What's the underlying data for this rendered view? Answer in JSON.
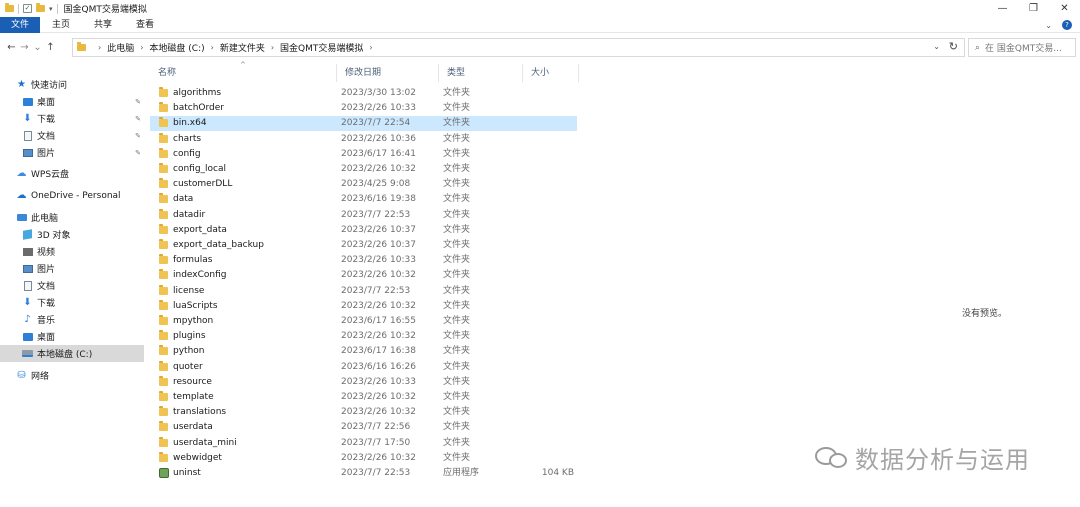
{
  "window": {
    "title": "国金QMT交易端模拟",
    "minimize": "—",
    "maximize": "❐",
    "close": "✕"
  },
  "ribbon": {
    "tabs": [
      "文件",
      "主页",
      "共享",
      "查看"
    ],
    "expand": "⌄",
    "help": "?"
  },
  "address": {
    "crumbs": [
      "此电脑",
      "本地磁盘 (C:)",
      "新建文件夹",
      "国金QMT交易端模拟"
    ],
    "search_placeholder": "在 国金QMT交易..."
  },
  "sidebar": {
    "quick_access": "快速访问",
    "quick_items": [
      "桌面",
      "下载",
      "文档",
      "图片"
    ],
    "wps": "WPS云盘",
    "onedrive": "OneDrive - Personal",
    "this_pc": "此电脑",
    "pc_items": [
      "3D 对象",
      "视频",
      "图片",
      "文档",
      "下载",
      "音乐",
      "桌面",
      "本地磁盘 (C:)"
    ],
    "network": "网络"
  },
  "columns": {
    "name": "名称",
    "date": "修改日期",
    "type": "类型",
    "size": "大小"
  },
  "files": [
    {
      "name": "algorithms",
      "date": "2023/3/30 13:02",
      "type": "文件夹",
      "size": ""
    },
    {
      "name": "batchOrder",
      "date": "2023/2/26 10:33",
      "type": "文件夹",
      "size": ""
    },
    {
      "name": "bin.x64",
      "date": "2023/7/7 22:54",
      "type": "文件夹",
      "size": ""
    },
    {
      "name": "charts",
      "date": "2023/2/26 10:36",
      "type": "文件夹",
      "size": ""
    },
    {
      "name": "config",
      "date": "2023/6/17 16:41",
      "type": "文件夹",
      "size": ""
    },
    {
      "name": "config_local",
      "date": "2023/2/26 10:32",
      "type": "文件夹",
      "size": ""
    },
    {
      "name": "customerDLL",
      "date": "2023/4/25 9:08",
      "type": "文件夹",
      "size": ""
    },
    {
      "name": "data",
      "date": "2023/6/16 19:38",
      "type": "文件夹",
      "size": ""
    },
    {
      "name": "datadir",
      "date": "2023/7/7 22:53",
      "type": "文件夹",
      "size": ""
    },
    {
      "name": "export_data",
      "date": "2023/2/26 10:37",
      "type": "文件夹",
      "size": ""
    },
    {
      "name": "export_data_backup",
      "date": "2023/2/26 10:37",
      "type": "文件夹",
      "size": ""
    },
    {
      "name": "formulas",
      "date": "2023/2/26 10:33",
      "type": "文件夹",
      "size": ""
    },
    {
      "name": "indexConfig",
      "date": "2023/2/26 10:32",
      "type": "文件夹",
      "size": ""
    },
    {
      "name": "license",
      "date": "2023/7/7 22:53",
      "type": "文件夹",
      "size": ""
    },
    {
      "name": "luaScripts",
      "date": "2023/2/26 10:32",
      "type": "文件夹",
      "size": ""
    },
    {
      "name": "mpython",
      "date": "2023/6/17 16:55",
      "type": "文件夹",
      "size": ""
    },
    {
      "name": "plugins",
      "date": "2023/2/26 10:32",
      "type": "文件夹",
      "size": ""
    },
    {
      "name": "python",
      "date": "2023/6/17 16:38",
      "type": "文件夹",
      "size": ""
    },
    {
      "name": "quoter",
      "date": "2023/6/16 16:26",
      "type": "文件夹",
      "size": ""
    },
    {
      "name": "resource",
      "date": "2023/2/26 10:33",
      "type": "文件夹",
      "size": ""
    },
    {
      "name": "template",
      "date": "2023/2/26 10:32",
      "type": "文件夹",
      "size": ""
    },
    {
      "name": "translations",
      "date": "2023/2/26 10:32",
      "type": "文件夹",
      "size": ""
    },
    {
      "name": "userdata",
      "date": "2023/7/7 22:56",
      "type": "文件夹",
      "size": ""
    },
    {
      "name": "userdata_mini",
      "date": "2023/7/7 17:50",
      "type": "文件夹",
      "size": ""
    },
    {
      "name": "webwidget",
      "date": "2023/2/26 10:32",
      "type": "文件夹",
      "size": ""
    },
    {
      "name": "uninst",
      "date": "2023/7/7 22:53",
      "type": "应用程序",
      "size": "104 KB"
    }
  ],
  "selected_file": "bin.x64",
  "preview": {
    "text": "没有预览。"
  },
  "watermark": {
    "text": "数据分析与运用"
  },
  "colors": {
    "accent": "#1a5fb4",
    "selection": "#cce8ff",
    "folder": "#f0c452"
  }
}
